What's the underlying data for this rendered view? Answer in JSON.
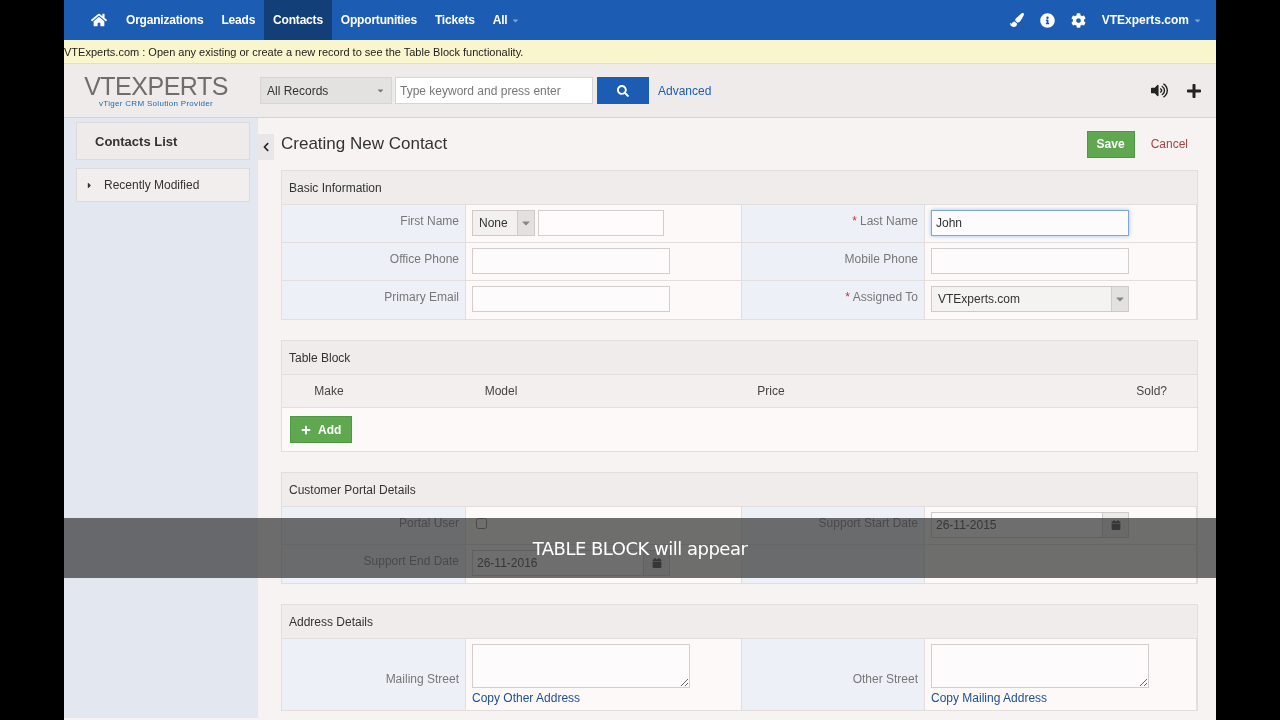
{
  "nav": {
    "items": [
      {
        "label": "Organizations",
        "selected": false,
        "kind": "link"
      },
      {
        "label": "Leads",
        "selected": false,
        "kind": "link"
      },
      {
        "label": "Contacts",
        "selected": true,
        "kind": "link"
      },
      {
        "label": "Opportunities",
        "selected": false,
        "kind": "link"
      },
      {
        "label": "Tickets",
        "selected": false,
        "kind": "link"
      },
      {
        "label": "All",
        "selected": false,
        "kind": "dropdown"
      }
    ],
    "user": "VTExperts.com"
  },
  "notice": "VTExperts.com : Open any existing or create a new record to see the Table Block functionality.",
  "logo": {
    "name": "VTEXPERTS",
    "tagline": "vTiger CRM Solution Provider"
  },
  "search": {
    "filter": "All Records",
    "placeholder": "Type keyword and press enter",
    "advanced": "Advanced"
  },
  "sidebar": {
    "title": "Contacts List",
    "items": [
      {
        "label": "Recently Modified",
        "expanded": false
      }
    ]
  },
  "page": {
    "title": "Creating New Contact",
    "save": "Save",
    "cancel": "Cancel"
  },
  "blocks": [
    {
      "kind": "fields",
      "title": "Basic Information",
      "rows": [
        [
          {
            "label": "First Name",
            "kind": "salutation",
            "value": "None"
          },
          {
            "label": "Last Name",
            "marker": "*",
            "kind": "text",
            "value": "John",
            "focused": true
          }
        ],
        [
          {
            "label": "Office Phone",
            "kind": "text"
          },
          {
            "label": "Mobile Phone",
            "kind": "text"
          }
        ],
        [
          {
            "label": "Primary Email",
            "kind": "text"
          },
          {
            "label": "Assigned To",
            "marker": "*",
            "kind": "select",
            "value": "VTExperts.com"
          }
        ]
      ]
    },
    {
      "kind": "table",
      "title": "Table Block",
      "columns": [
        "Make",
        "Model",
        "Price",
        "Sold?"
      ],
      "add": "Add"
    },
    {
      "kind": "fields",
      "title": "Customer Portal Details",
      "rows": [
        [
          {
            "label": "Portal User",
            "kind": "checkbox",
            "checked": false
          },
          {
            "label": "Support Start Date",
            "kind": "date",
            "value": "26-11-2015"
          }
        ],
        [
          {
            "label": "Support End Date",
            "kind": "date",
            "value": "26-11-2016"
          },
          {
            "kind": "empty"
          }
        ]
      ]
    },
    {
      "kind": "fields",
      "title": "Address Details",
      "rows": [
        [
          {
            "label": "Mailing Street",
            "kind": "textarea",
            "link": "Copy Other Address"
          },
          {
            "label": "Other Street",
            "kind": "textarea",
            "link": "Copy Mailing Address"
          }
        ]
      ]
    }
  ],
  "caption": "TABLE BLOCK will appear"
}
